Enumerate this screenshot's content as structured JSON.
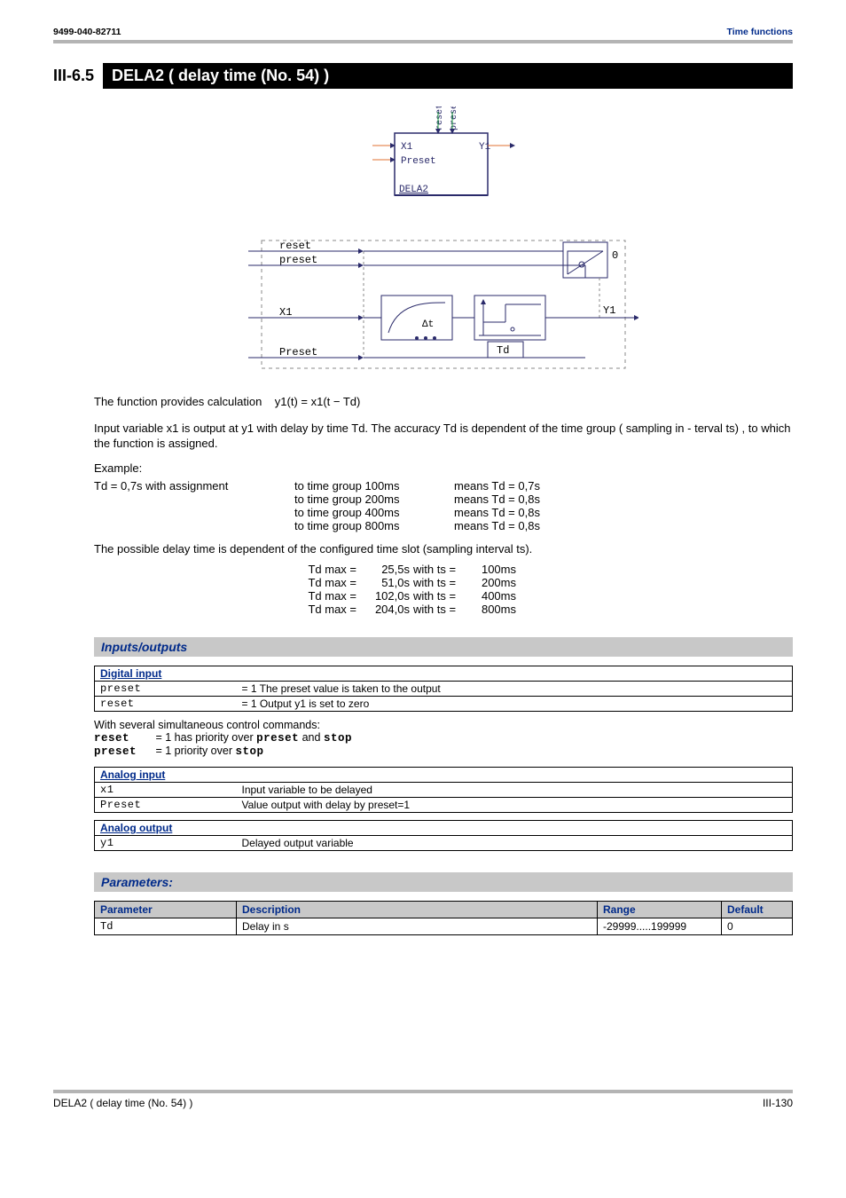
{
  "header": {
    "left": "9499-040-82711",
    "right": "Time functions"
  },
  "section": {
    "number": "III-6.5",
    "title": "DELA2 ( delay time (No. 54) )"
  },
  "diagram": {
    "block": {
      "x1": "X1",
      "preset_in": "Preset",
      "reset": "reset",
      "preset_top": "preset",
      "y1": "Y1",
      "name": "DELA2"
    },
    "lower": {
      "reset": "reset",
      "preset": "preset",
      "x1": "X1",
      "preset_in": "Preset",
      "y1": "Y1",
      "td": "Td",
      "delta_t": "Δt",
      "zero": "0"
    }
  },
  "formula": {
    "lead": "The function provides calculation",
    "expr": "y1(t) = x1(t − Td)"
  },
  "desc": "Input variable x1 is output at y1 with delay by time Td. The accuracy Td is dependent of the time group ( sampling in - terval ts) , to which the function is assigned.",
  "example": {
    "label": "Example:",
    "left": "Td = 0,7s with assignment",
    "rows": [
      {
        "mid": "to time group  100ms",
        "right": "means Td = 0,7s"
      },
      {
        "mid": "to time group  200ms",
        "right": "means Td = 0,8s"
      },
      {
        "mid": "to time group  400ms",
        "right": "means Td = 0,8s"
      },
      {
        "mid": "to time group  800ms",
        "right": "means Td = 0,8s"
      }
    ]
  },
  "tdmax": {
    "intro": "The possible delay time is dependent of the configured time slot (sampling interval ts).",
    "rows": [
      {
        "l": "Td max =",
        "v": "25,5s",
        "w": "with ts =",
        "t": "100ms"
      },
      {
        "l": "Td max =",
        "v": "51,0s",
        "w": "with ts =",
        "t": "200ms"
      },
      {
        "l": "Td max =",
        "v": "102,0s",
        "w": "with ts =",
        "t": "400ms"
      },
      {
        "l": "Td max =",
        "v": "204,0s",
        "w": "with ts =",
        "t": "800ms"
      }
    ]
  },
  "io": {
    "heading": "Inputs/outputs",
    "digital": {
      "group": "Digital input",
      "rows": [
        {
          "label": "preset",
          "desc": "= 1  The preset value is taken to the output"
        },
        {
          "label": "reset",
          "desc": "= 1  Output y1 is set to zero"
        }
      ]
    },
    "priority": {
      "intro": "With several simultaneous control commands:",
      "l1a": "reset",
      "l1b": "= 1 has priority over",
      "l1c": "preset",
      "l1d": "and",
      "l1e": "stop",
      "l2a": "preset",
      "l2b": "= 1 priority over",
      "l2c": "stop"
    },
    "analog_in": {
      "group": "Analog input",
      "rows": [
        {
          "label": "x1",
          "desc": "Input variable to be delayed"
        },
        {
          "label": "Preset",
          "desc": "Value output with delay by preset=1"
        }
      ]
    },
    "analog_out": {
      "group": "Analog output",
      "rows": [
        {
          "label": "y1",
          "desc": "Delayed output variable"
        }
      ]
    }
  },
  "params": {
    "heading": "Parameters:",
    "head": {
      "p": "Parameter",
      "d": "Description",
      "r": "Range",
      "def": "Default"
    },
    "rows": [
      {
        "p": "Td",
        "d": "Delay in s",
        "r": "-29999.....199999",
        "def": "0"
      }
    ]
  },
  "footer": {
    "left": "DELA2 ( delay time (No. 54) )",
    "right": "III-130"
  }
}
